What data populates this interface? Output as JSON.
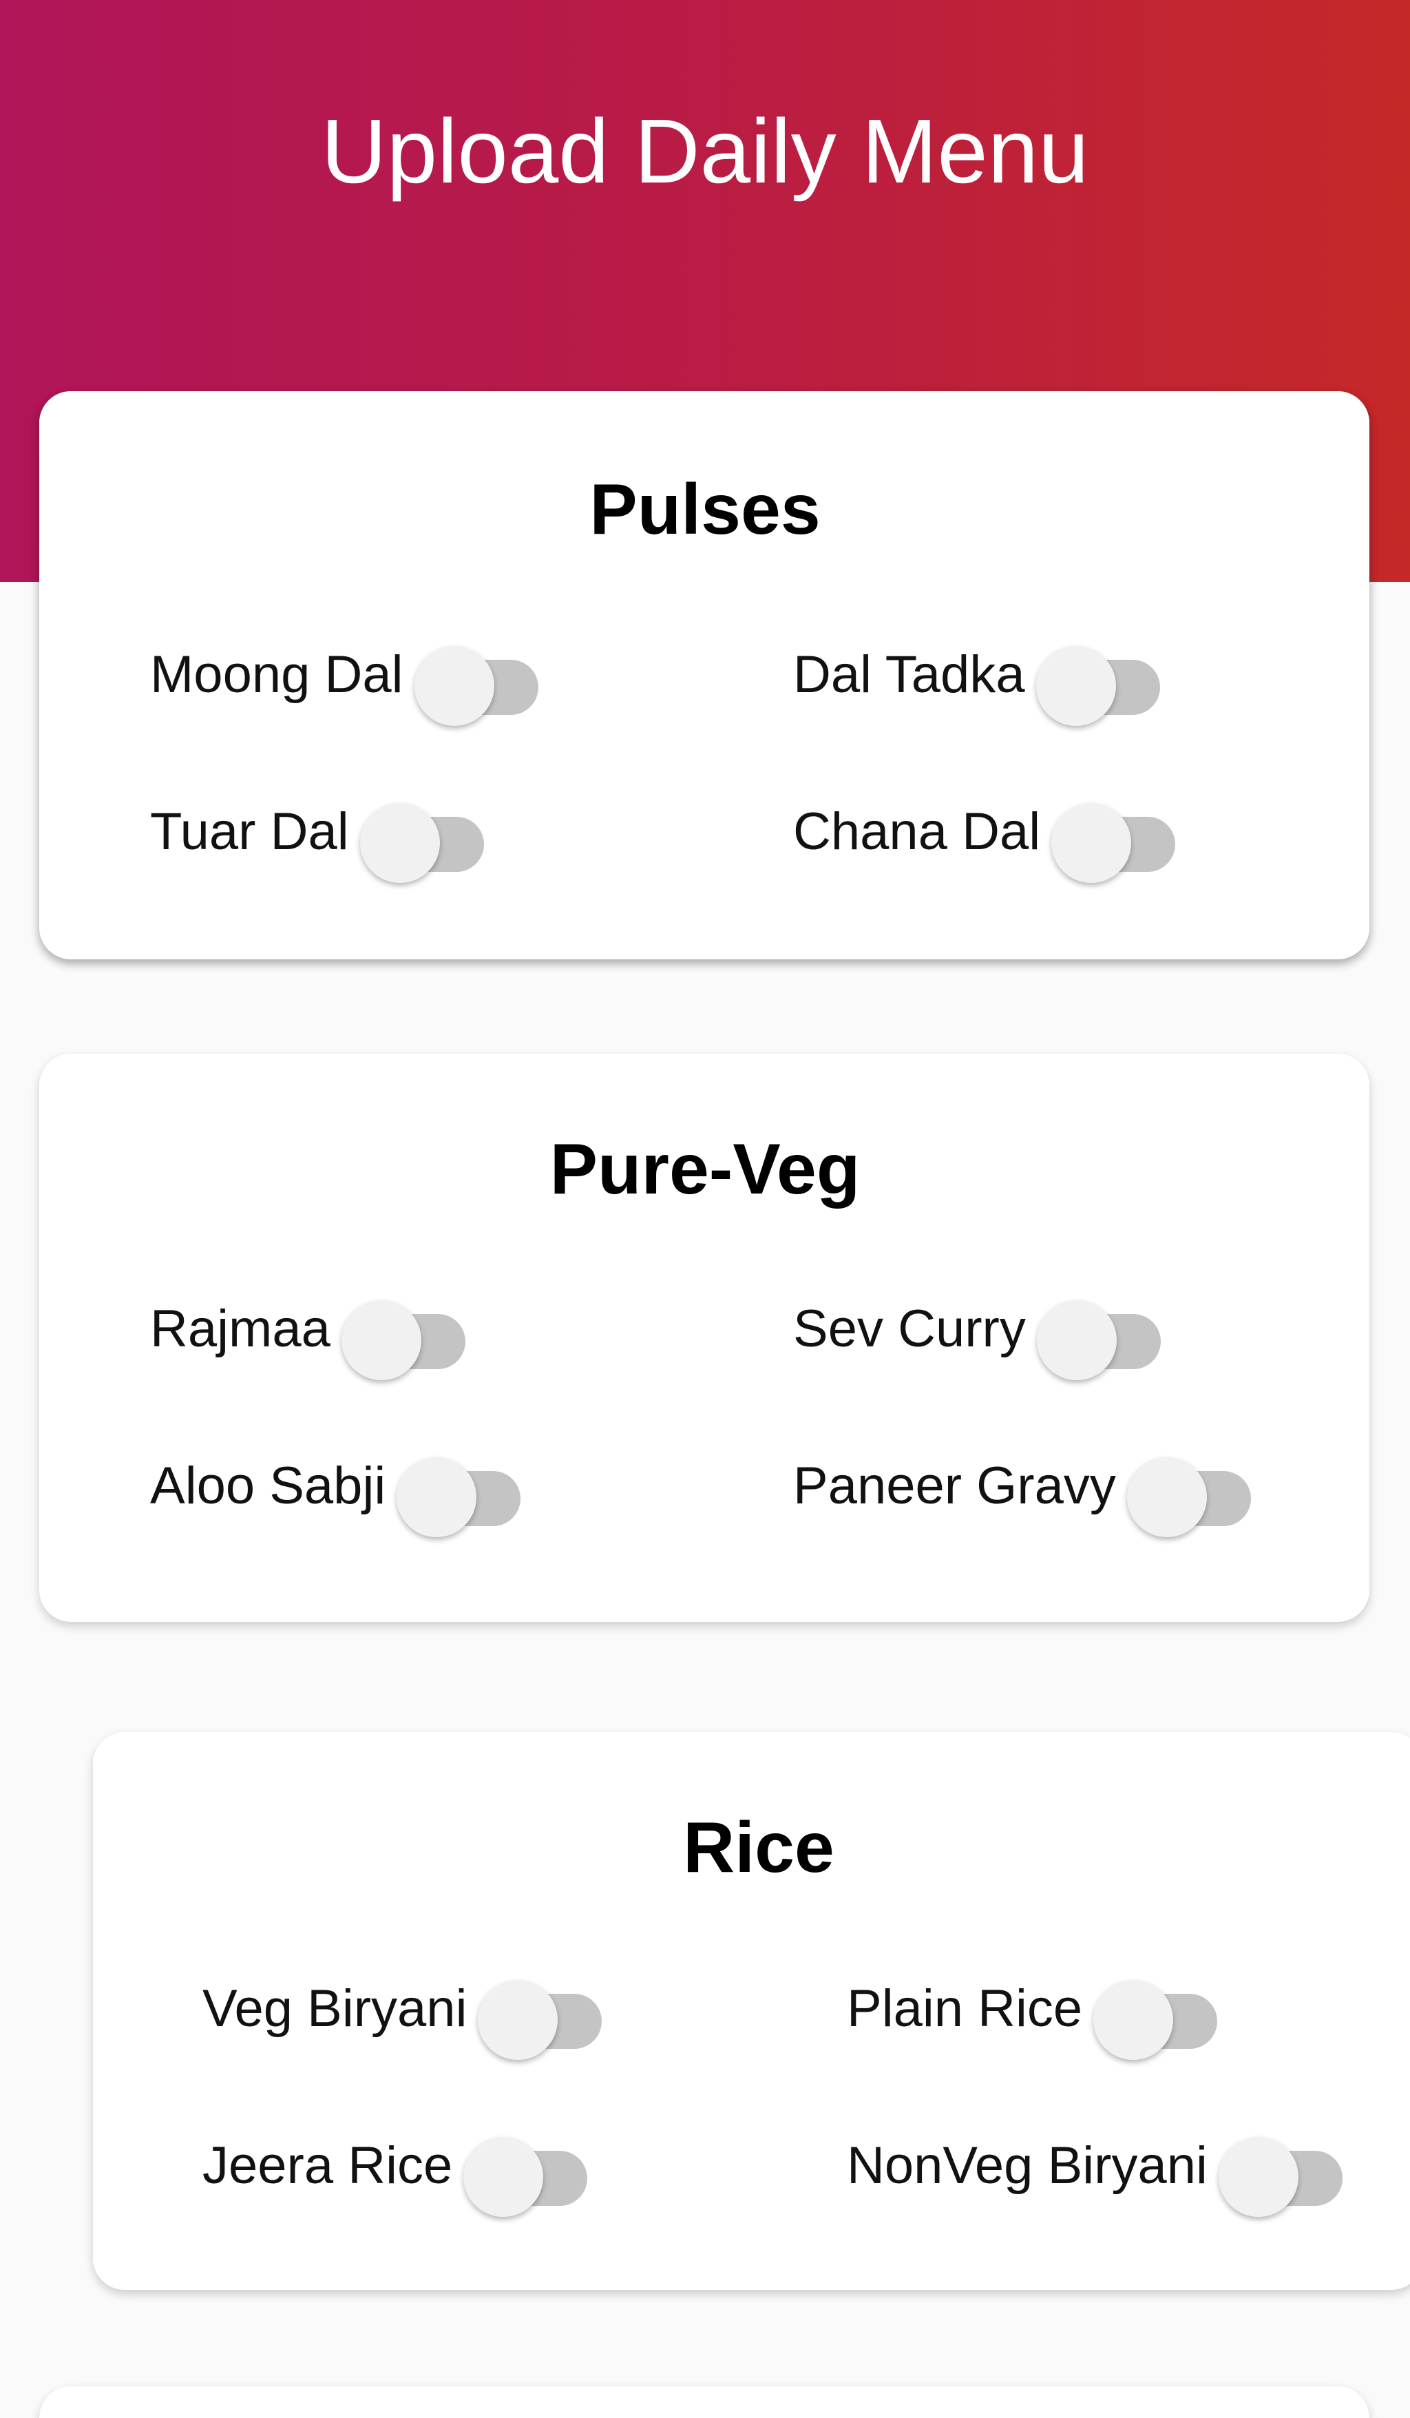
{
  "header": {
    "title": "Upload Daily Menu"
  },
  "colors": {
    "header_gradient_start": "#b01559",
    "header_gradient_end": "#c62828",
    "switch_track": "#c4c4c4",
    "switch_knob": "#f1f1f1",
    "page_background": "#fafafa"
  },
  "sections": [
    {
      "title": "Pulses",
      "items": [
        {
          "label": "Moong Dal",
          "on": false
        },
        {
          "label": "Dal Tadka",
          "on": false
        },
        {
          "label": "Tuar Dal",
          "on": false
        },
        {
          "label": "Chana Dal",
          "on": false
        }
      ]
    },
    {
      "title": "Pure-Veg",
      "items": [
        {
          "label": "Rajmaa",
          "on": false
        },
        {
          "label": "Sev Curry",
          "on": false
        },
        {
          "label": "Aloo Sabji",
          "on": false
        },
        {
          "label": "Paneer Gravy",
          "on": false
        }
      ]
    },
    {
      "title": "Rice",
      "items": [
        {
          "label": "Veg Biryani",
          "on": false
        },
        {
          "label": "Plain Rice",
          "on": false
        },
        {
          "label": "Jeera Rice",
          "on": false
        },
        {
          "label": "NonVeg Biryani",
          "on": false
        }
      ]
    }
  ]
}
